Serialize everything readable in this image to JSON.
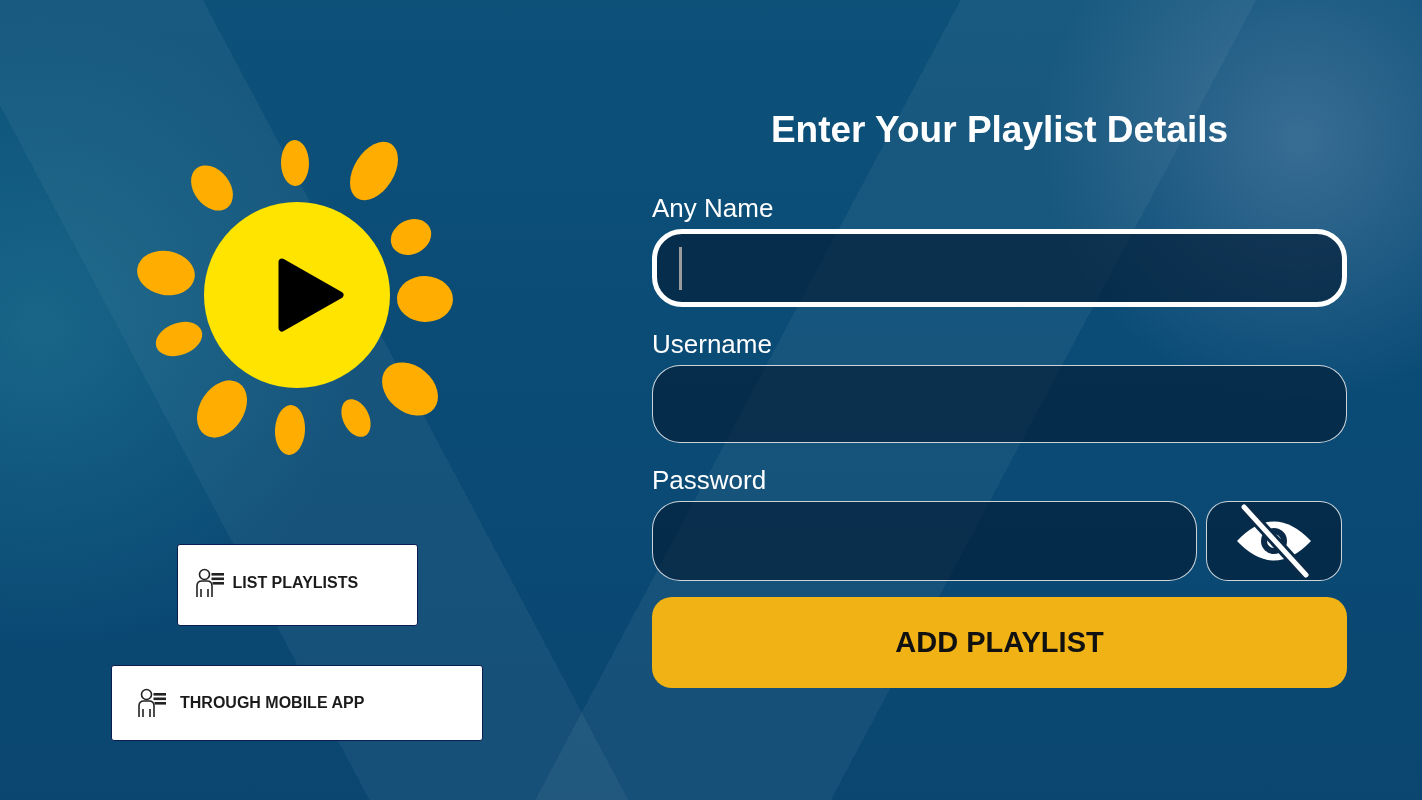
{
  "side_buttons": [
    {
      "label": "LIST PLAYLISTS"
    },
    {
      "label": "THROUGH MOBILE APP"
    }
  ],
  "form": {
    "title": "Enter Your Playlist Details",
    "fields": [
      {
        "label": "Any Name",
        "kind": "text",
        "focused": true
      },
      {
        "label": "Username",
        "kind": "text",
        "focused": false
      },
      {
        "label": "Password",
        "kind": "password",
        "focused": false,
        "revealed": false
      }
    ],
    "submit": "ADD PLAYLIST"
  }
}
